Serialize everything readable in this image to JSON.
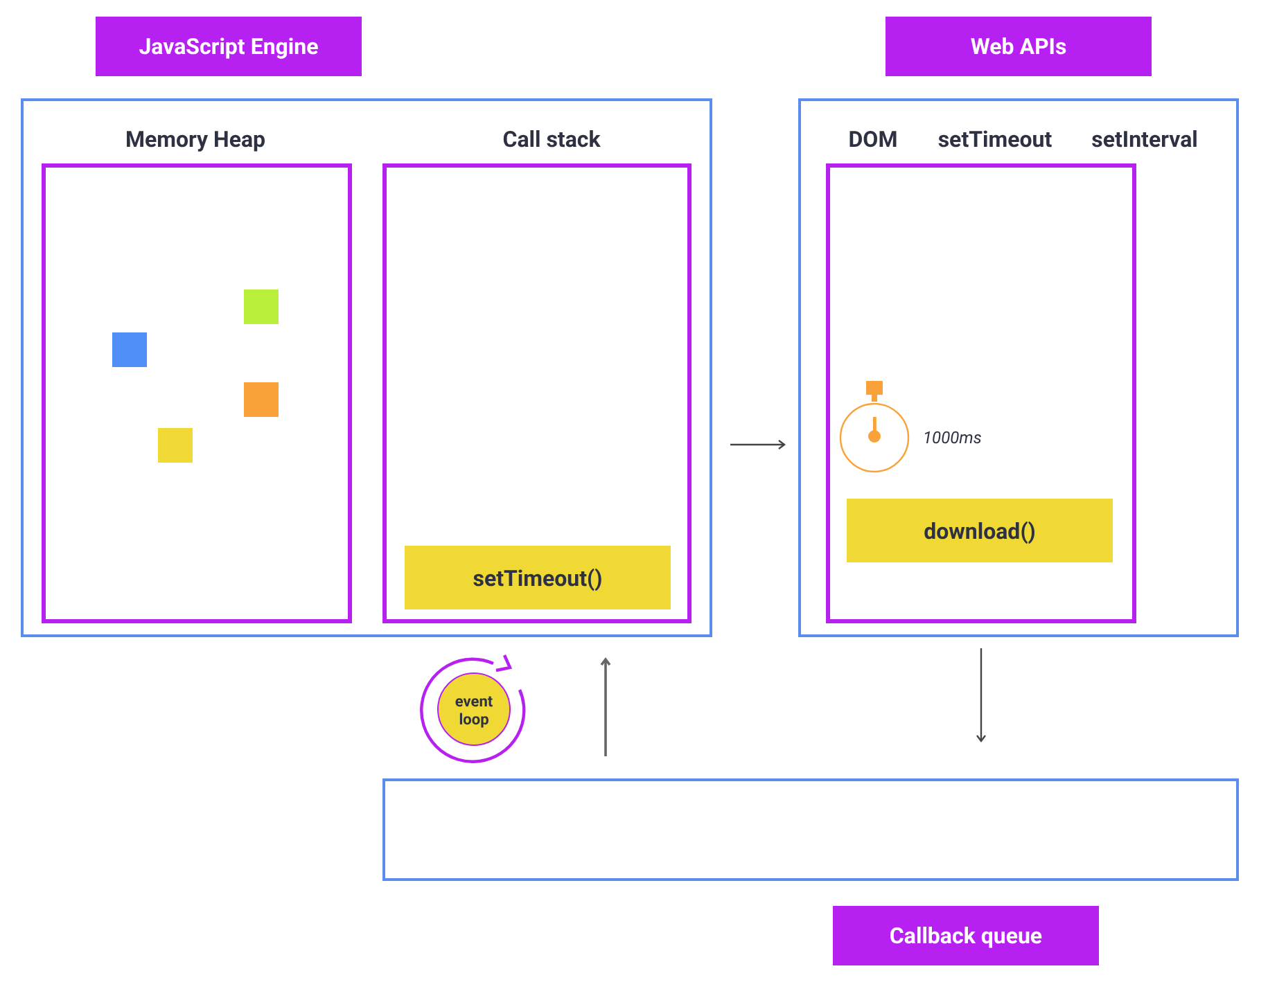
{
  "engine": {
    "title": "JavaScript Engine",
    "heap": {
      "title": "Memory Heap",
      "objects": [
        {
          "color": "#4f8ef7"
        },
        {
          "color": "#b9f03c"
        },
        {
          "color": "#f9a23a"
        },
        {
          "color": "#f0d934"
        }
      ]
    },
    "call_stack": {
      "title": "Call stack",
      "frames": [
        "setTimeout()"
      ]
    }
  },
  "web_apis": {
    "title": "Web APIs",
    "apis": [
      "DOM",
      "setTimeout",
      "setInterval"
    ],
    "timer": {
      "label": "1000ms"
    },
    "tasks": [
      "download()"
    ]
  },
  "event_loop": {
    "label": "event loop"
  },
  "callback_queue": {
    "title": "Callback queue"
  }
}
